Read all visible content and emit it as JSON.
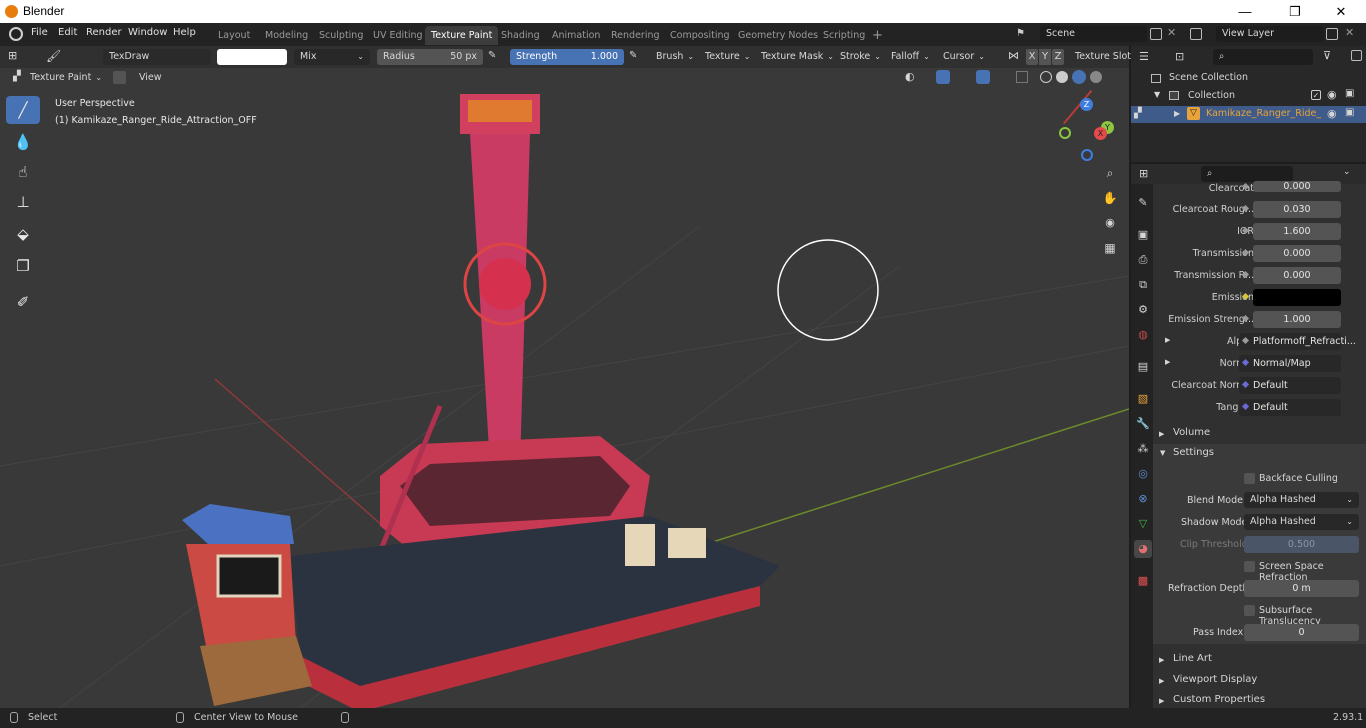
{
  "window": {
    "title": "Blender",
    "min_glyph": "—",
    "max_glyph": "❐",
    "close_glyph": "✕"
  },
  "menu": {
    "items": [
      "File",
      "Edit",
      "Render",
      "Window",
      "Help"
    ]
  },
  "workspaces": {
    "tabs": [
      "Layout",
      "Modeling",
      "Sculpting",
      "UV Editing",
      "Texture Paint",
      "Shading",
      "Animation",
      "Rendering",
      "Compositing",
      "Geometry Nodes",
      "Scripting"
    ],
    "active": "Texture Paint",
    "add_glyph": "+"
  },
  "scene": {
    "scene_name": "Scene",
    "view_layer": "View Layer"
  },
  "tool_header": {
    "brush_name": "TexDraw",
    "blend": "Mix",
    "radius_label": "Radius",
    "radius_value": "50 px",
    "strength_label": "Strength",
    "strength_value": "1.000",
    "menus": [
      "Brush",
      "Texture",
      "Texture Mask",
      "Stroke",
      "Falloff",
      "Cursor"
    ],
    "axes": [
      "X",
      "Y",
      "Z"
    ],
    "texture_slots": "Texture Slots"
  },
  "viewport_header": {
    "mode": "Texture Paint",
    "view": "View"
  },
  "viewport": {
    "perspective": "User Perspective",
    "object": "(1) Kamikaze_Ranger_Ride_Attraction_OFF",
    "gizmo": {
      "x": "X",
      "y": "Y",
      "z": "Z"
    }
  },
  "outliner": {
    "root": "Scene Collection",
    "collection": "Collection",
    "object": "Kamikaze_Ranger_Ride_"
  },
  "properties": {
    "rows": [
      {
        "label": "Clearcoat",
        "value": "0.000"
      },
      {
        "label": "Clearcoat Roug...",
        "value": "0.030"
      },
      {
        "label": "IOR",
        "value": "1.600"
      },
      {
        "label": "Transmission",
        "value": "0.000"
      },
      {
        "label": "Transmission R...",
        "value": "0.000"
      },
      {
        "label": "Emission",
        "value": ""
      },
      {
        "label": "Emission Streng...",
        "value": "1.000"
      },
      {
        "label": "Alpha",
        "value": "Platformoff_Refracti..."
      },
      {
        "label": "Normal",
        "value": "Normal/Map"
      },
      {
        "label": "Clearcoat Normal",
        "value": "Default"
      },
      {
        "label": "Tangent",
        "value": "Default"
      }
    ],
    "volume": "Volume",
    "settings": "Settings",
    "backface_culling": "Backface Culling",
    "blend_mode_label": "Blend Mode",
    "blend_mode": "Alpha Hashed",
    "shadow_mode_label": "Shadow Mode",
    "shadow_mode": "Alpha Hashed",
    "clip_threshold_label": "Clip Threshold",
    "clip_threshold": "0.500",
    "ssr": "Screen Space Refraction",
    "refraction_depth_label": "Refraction Depth",
    "refraction_depth": "0 m",
    "sss": "Subsurface Translucency",
    "pass_index_label": "Pass Index",
    "pass_index": "0",
    "line_art": "Line Art",
    "viewport_display": "Viewport Display",
    "custom_properties": "Custom Properties"
  },
  "status": {
    "select": "Select",
    "center": "Center View to Mouse",
    "version": "2.93.1"
  },
  "colors": {
    "accent": "#4772b3",
    "active_tab": "#3d3d3d",
    "viewport": "#393939",
    "object_highlight": "#e8a43a"
  }
}
